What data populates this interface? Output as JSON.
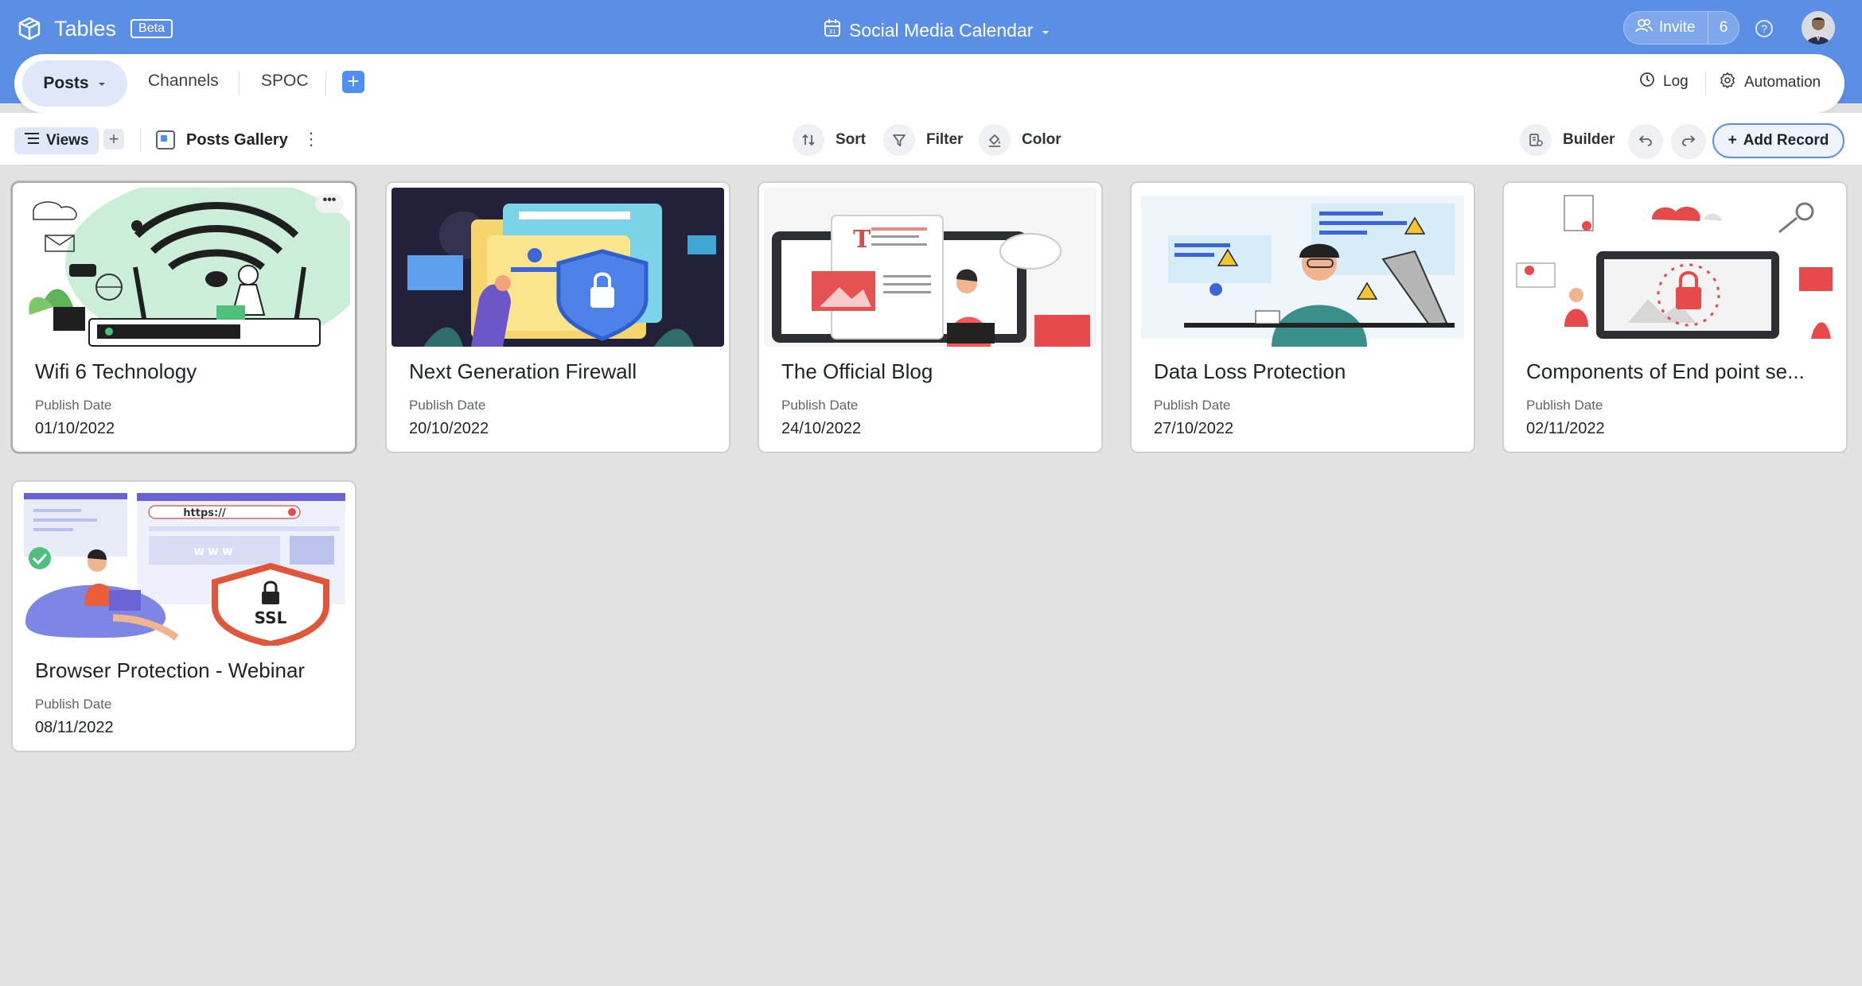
{
  "app": {
    "name": "Tables",
    "badge": "Beta",
    "base_title": "Social Media Calendar",
    "invite_label": "Invite",
    "invite_count": "6",
    "help_glyph": "?"
  },
  "tabs": {
    "active": "Posts",
    "items": [
      "Channels",
      "SPOC"
    ],
    "add_glyph": "+",
    "log_label": "Log",
    "automation_label": "Automation"
  },
  "toolbar": {
    "views_label": "Views",
    "views_add_glyph": "+",
    "view_name": "Posts Gallery",
    "sort_label": "Sort",
    "filter_label": "Filter",
    "color_label": "Color",
    "builder_label": "Builder",
    "add_record_label": "Add Record",
    "add_record_glyph": "+"
  },
  "cards": [
    {
      "title": "Wifi 6 Technology",
      "field_label": "Publish Date",
      "date": "01/10/2022",
      "image": "wifi-illustration",
      "more": "•••"
    },
    {
      "title": "Next Generation Firewall",
      "field_label": "Publish Date",
      "date": "20/10/2022",
      "image": "firewall-illustration"
    },
    {
      "title": "The Official Blog",
      "field_label": "Publish Date",
      "date": "24/10/2022",
      "image": "blog-illustration"
    },
    {
      "title": "Data Loss Protection",
      "field_label": "Publish Date",
      "date": "27/10/2022",
      "image": "dlp-illustration"
    },
    {
      "title": "Components of End point se...",
      "field_label": "Publish Date",
      "date": "02/11/2022",
      "image": "endpoint-illustration"
    },
    {
      "title": "Browser Protection - Webinar",
      "field_label": "Publish Date",
      "date": "08/11/2022",
      "image": "browser-ssl-illustration",
      "image_text": [
        "https://",
        "www",
        "SSL"
      ]
    }
  ],
  "colors": {
    "header": "#5b8fe6",
    "accent": "#4d8ff2",
    "canvas": "#e2e2e2"
  }
}
